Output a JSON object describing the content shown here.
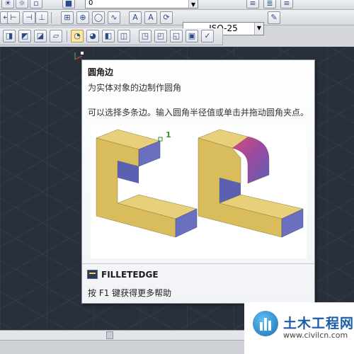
{
  "toolbar": {
    "dimstyle_value": "ISO-25",
    "layer_value": "0"
  },
  "tooltip": {
    "title": "圆角边",
    "description": "为实体对象的边制作圆角",
    "extended": "可以选择多条边。输入圆角半径值或单击并拖动圆角夹点。",
    "callout": "1",
    "command": "FILLETEDGE",
    "help": "按 F1 键获得更多帮助"
  },
  "watermark": {
    "title": "土木工程网",
    "url": "www.civilcn.com"
  },
  "colors": {
    "canvas": "#2a303b",
    "solid_face": "#e3c76a",
    "solid_side": "#6b6fc0",
    "fillet_highlight": "#d0507a",
    "brand": "#1b5da8"
  }
}
